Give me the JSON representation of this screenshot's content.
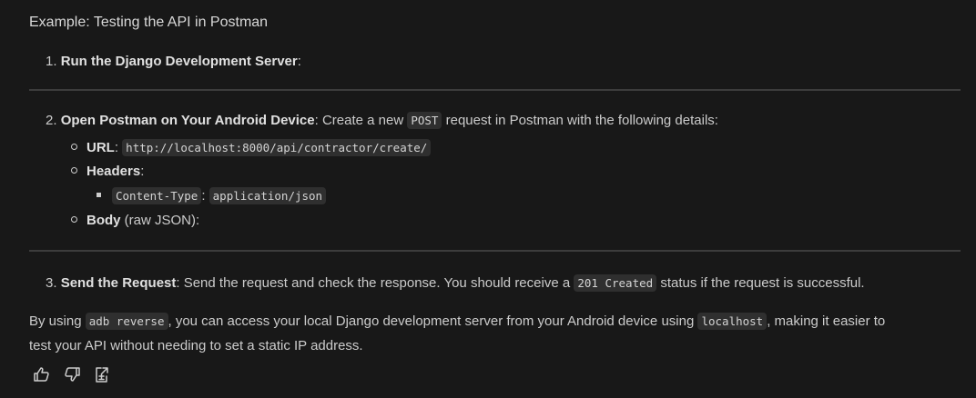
{
  "heading": "Example: Testing the API in Postman",
  "steps": [
    {
      "num": "1.",
      "title": "Run the Django Development Server",
      "rest": ":"
    },
    {
      "num": "2.",
      "title": "Open Postman on Your Android Device",
      "rest_a": ": Create a new ",
      "code": "POST",
      "rest_b": " request in Postman with the following details:",
      "url_label": "URL",
      "url": "http://localhost:8000/api/contractor/create/",
      "headers_label": "Headers",
      "header_key": "Content-Type",
      "header_value": "application/json",
      "body_label": "Body",
      "body_rest": " (raw JSON):"
    },
    {
      "num": "3.",
      "title": "Send the Request",
      "rest_a": ": Send the request and check the response. You should receive a ",
      "code": "201 Created",
      "rest_b": " status if the request is successful."
    }
  ],
  "summary": {
    "a": "By using ",
    "code1": "adb reverse",
    "b": ", you can access your local Django development server from your Android device using ",
    "code2": "localhost",
    "c": ", making it easier to",
    "line2": "test your API without needing to set a static IP address."
  },
  "actions": {
    "like": "thumbs-up-icon",
    "dislike": "thumbs-down-icon",
    "export": "export-icon"
  }
}
